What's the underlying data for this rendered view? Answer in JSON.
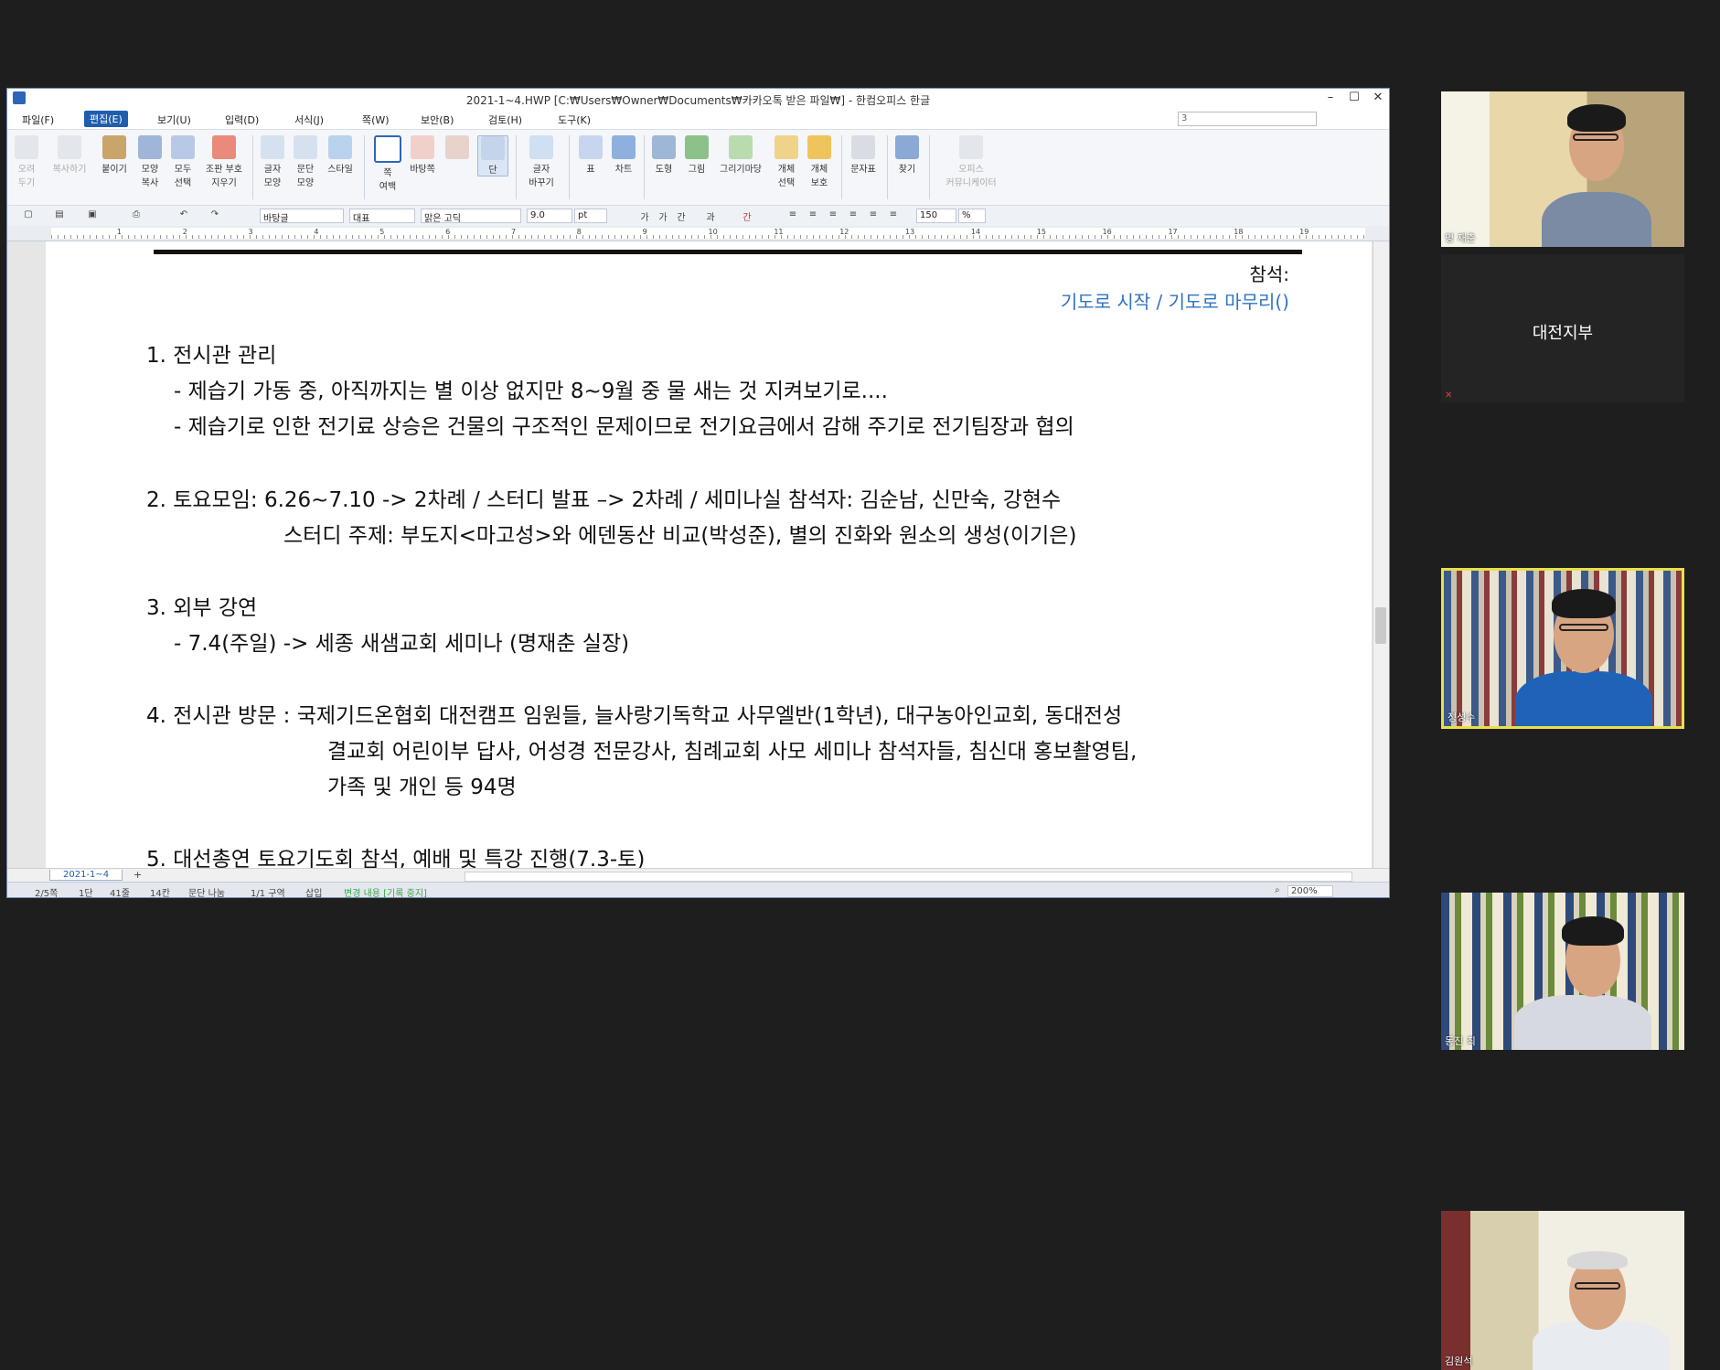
{
  "window": {
    "title": "2021-1~4.HWP [C:₩Users₩Owner₩Documents₩카카오톡 받은 파일₩] - 한컴오피스 한글",
    "controls": [
      "–",
      "☐",
      "✕"
    ]
  },
  "menubar": {
    "items": [
      "파일(F)",
      "편집(E)",
      "보기(U)",
      "입력(D)",
      "서식(J)",
      "쪽(W)",
      "보안(B)",
      "검토(H)",
      "도구(K)"
    ],
    "active": "편집(E)",
    "right_combo": "3"
  },
  "ribbon": {
    "buttons": [
      {
        "label": "오려\n두기"
      },
      {
        "label": "복사하기"
      },
      {
        "label": "붙이기"
      },
      {
        "label": "모양\n복사"
      },
      {
        "label": "모두\n선택"
      },
      {
        "label": "조판 부호\n지우기"
      },
      {
        "label": "글자\n모양"
      },
      {
        "label": "문단\n모양"
      },
      {
        "label": "스타일"
      },
      {
        "label": "쪽\n여백"
      },
      {
        "label": "바탕쪽"
      },
      {
        "label": "단"
      },
      {
        "label": "글자\n바꾸기"
      },
      {
        "label": "표"
      },
      {
        "label": "차트"
      },
      {
        "label": "도형"
      },
      {
        "label": "그림"
      },
      {
        "label": "그리기마당"
      },
      {
        "label": "개체\n선택"
      },
      {
        "label": "개체\n보호"
      },
      {
        "label": "문자표"
      },
      {
        "label": "찾기"
      },
      {
        "label": "오피스\n커뮤니케이터"
      }
    ]
  },
  "format_bar": {
    "style": "바탕글",
    "font_class": "대표",
    "font": "맑은 고딕",
    "size": "9.0",
    "unit": "pt",
    "char_buttons": [
      "가",
      "가",
      "간",
      "과",
      "간"
    ],
    "line_spacing": "150",
    "line_unit": "%"
  },
  "ruler_numbers": [
    "1",
    "2",
    "3",
    "4",
    "5",
    "6",
    "7",
    "8",
    "9",
    "10",
    "11",
    "12",
    "13",
    "14",
    "15",
    "16",
    "17",
    "18",
    "19"
  ],
  "document": {
    "attendance_label": "참석:",
    "prayer_line": "기도로 시작 /   기도로 마무리()",
    "items": [
      {
        "line": "1. 전시관 관리"
      },
      {
        "line": "- 제습기 가동 중, 아직까지는 별 이상 없지만 8~9월 중 물 새는 것 지켜보기로...."
      },
      {
        "line": "- 제습기로 인한 전기료 상승은 건물의 구조적인 문제이므로 전기요금에서 감해 주기로 전기팀장과 협의"
      },
      {
        "line": "2. 토요모임: 6.26~7.10 -> 2차례   /   스터디 발표 –> 2차례   /   세미나실 참석자: 김순남, 신만숙, 강현수"
      },
      {
        "line": "스터디 주제: 부도지<마고성>와 에덴동산 비교(박성준), 별의 진화와 원소의 생성(이기은)"
      },
      {
        "line": "3. 외부 강연"
      },
      {
        "line": "- 7.4(주일) -> 세종 새샘교회 세미나 (명재춘 실장)"
      },
      {
        "line": "4. 전시관 방문 : 국제기드온협회 대전캠프 임원들, 늘사랑기독학교 사무엘반(1학년), 대구농아인교회, 동대전성"
      },
      {
        "line": "결교회 어린이부 답사, 어성경 전문강사, 침례교회 사모 세미나 참석자들, 침신대 홍보촬영팀,"
      },
      {
        "line": "가족 및 개인 등 94명"
      },
      {
        "line": "5. 대선총연 토요기도회 참석, 예배 및 특강 진행(7.3-토)"
      }
    ]
  },
  "doc_tab": "2021-1~4",
  "doc_tab_add": "+",
  "status": {
    "page": "2/5쪽",
    "section": "1단",
    "line": "41줄",
    "column": "14칸",
    "para": "문단 나눔",
    "area": "1/1 구역",
    "mode": "삽입",
    "track": "변경 내용 [기록 중지]",
    "zoom": "200%"
  },
  "participants": [
    {
      "name": "명 재춘"
    },
    {
      "name": "대전지부"
    },
    {
      "name": "정성수"
    },
    {
      "name": "동진 최"
    },
    {
      "name": "김원석"
    }
  ]
}
